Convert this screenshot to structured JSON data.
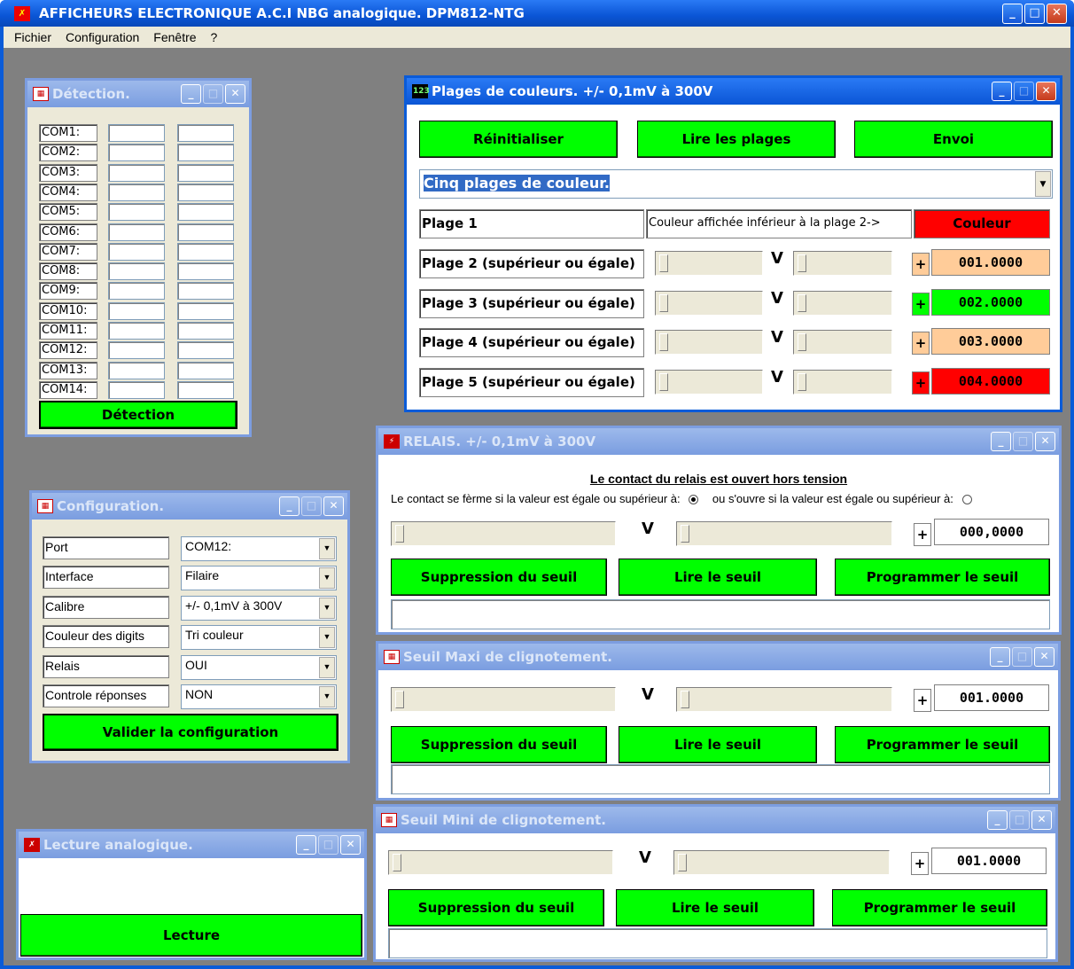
{
  "app": {
    "title": "AFFICHEURS ELECTRONIQUE A.C.I  NBG analogique. DPM812-NTG",
    "icon": "app-icon"
  },
  "menu": [
    "Fichier",
    "Configuration",
    "Fenêtre",
    "?"
  ],
  "colors": {
    "green": "#00ff00",
    "red": "#ff0000",
    "orange": "#ffcc99",
    "titlebar": "#0a5bd8"
  },
  "detection": {
    "title": "Détection.",
    "ports": [
      "COM1:",
      "COM2:",
      "COM3:",
      "COM4:",
      "COM5:",
      "COM6:",
      "COM7:",
      "COM8:",
      "COM9:",
      "COM10:",
      "COM11:",
      "COM12:",
      "COM13:",
      "COM14:"
    ],
    "button": "Détection"
  },
  "configuration": {
    "title": "Configuration.",
    "rows": [
      {
        "label": "Port",
        "value": "COM12:"
      },
      {
        "label": "Interface",
        "value": "Filaire"
      },
      {
        "label": "Calibre",
        "value": "+/- 0,1mV à 300V"
      },
      {
        "label": "Couleur des digits",
        "value": "Tri couleur"
      },
      {
        "label": "Relais",
        "value": "OUI"
      },
      {
        "label": "Controle réponses",
        "value": "NON"
      }
    ],
    "button": "Valider la configuration"
  },
  "lecture": {
    "title": "Lecture analogique.",
    "button": "Lecture"
  },
  "plages": {
    "title": "Plages de couleurs. +/- 0,1mV à 300V",
    "btn_reset": "Réinitialiser",
    "btn_read": "Lire les plages",
    "btn_send": "Envoi",
    "combo": "Cinq plages de couleur.",
    "plage1": "Plage 1",
    "plage1_desc": "Couleur affichée inférieur à la plage 2->",
    "plage1_color": "Couleur",
    "rows": [
      {
        "label": "Plage 2 (supérieur ou égale)",
        "value": "001.0000",
        "sign": "+",
        "color": "#ffcc99"
      },
      {
        "label": "Plage 3 (supérieur ou égale)",
        "value": "002.0000",
        "sign": "+",
        "color": "#00ff00"
      },
      {
        "label": "Plage 4 (supérieur ou égale)",
        "value": "003.0000",
        "sign": "+",
        "color": "#ffcc99"
      },
      {
        "label": "Plage 5 (supérieur ou égale)",
        "value": "004.0000",
        "sign": "+",
        "color": "#ff0000"
      }
    ]
  },
  "relais": {
    "title": "RELAIS. +/- 0,1mV à 300V",
    "heading": "Le contact du relais est ouvert hors tension",
    "closes": "Le contact se fèrme si la valeur est égale ou supérieur à:",
    "opens": "ou s'ouvre si la valeur est égale ou supérieur à:",
    "sign": "+",
    "value": "000,0000",
    "btn_delete": "Suppression du seuil",
    "btn_read": "Lire le seuil",
    "btn_program": "Programmer le seuil"
  },
  "maxi": {
    "title": "Seuil Maxi de clignotement.",
    "sign": "+",
    "value": "001.0000",
    "btn_delete": "Suppression du seuil",
    "btn_read": "Lire le seuil",
    "btn_program": "Programmer le seuil"
  },
  "mini": {
    "title": "Seuil Mini de clignotement.",
    "sign": "+",
    "value": "001.0000",
    "btn_delete": "Suppression du seuil",
    "btn_read": "Lire le seuil",
    "btn_program": "Programmer le seuil"
  },
  "v_unit": "V"
}
